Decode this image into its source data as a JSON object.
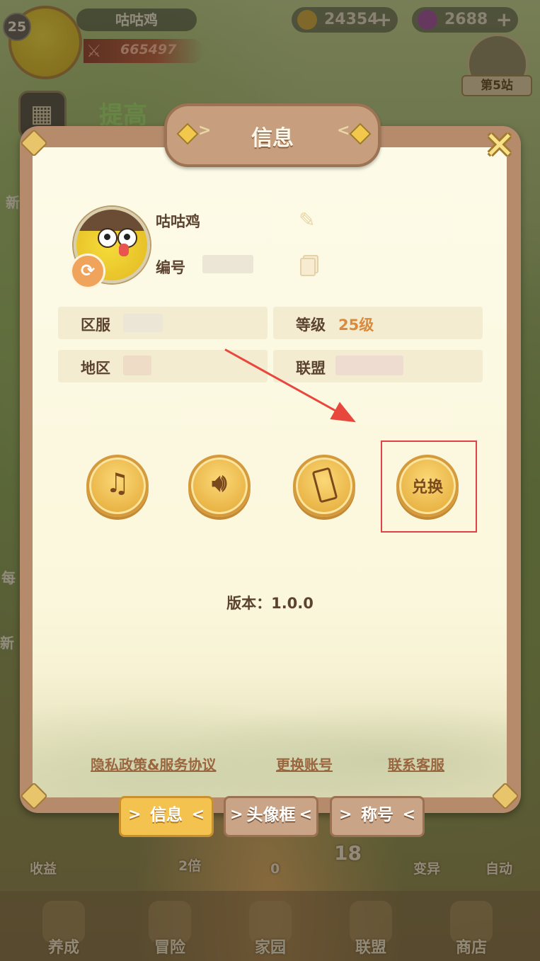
{
  "hud": {
    "level": "25",
    "player_name": "咕咕鸡",
    "power": "665497",
    "coins": "24354",
    "gems": "2688",
    "station": "第5站",
    "promo": "提高"
  },
  "side_labels": [
    "新",
    "每",
    "新",
    "收益",
    "2倍",
    "0",
    "18",
    "变异",
    "自动"
  ],
  "bottom_nav": [
    {
      "label": "养成"
    },
    {
      "label": "冒险"
    },
    {
      "label": "家园"
    },
    {
      "label": "联盟"
    },
    {
      "label": "商店"
    }
  ],
  "modal": {
    "title": "信息",
    "profile": {
      "name": "咕咕鸡",
      "id_label": "编号"
    },
    "info": {
      "server_label": "区服",
      "level_label": "等级",
      "level_value": "25级",
      "region_label": "地区",
      "alliance_label": "联盟"
    },
    "buttons": {
      "redeem_label": "兑换"
    },
    "version": "版本：1.0.0",
    "links": {
      "privacy": "隐私政策&服务协议",
      "switch_account": "更换账号",
      "contact": "联系客服"
    },
    "tabs": [
      {
        "label": "信息",
        "active": true
      },
      {
        "label": "头像框",
        "active": false
      },
      {
        "label": "称号",
        "active": false
      }
    ]
  },
  "colors": {
    "accent": "#d98a3c",
    "highlight_box": "#e2414a",
    "arrow": "#e8473d"
  }
}
